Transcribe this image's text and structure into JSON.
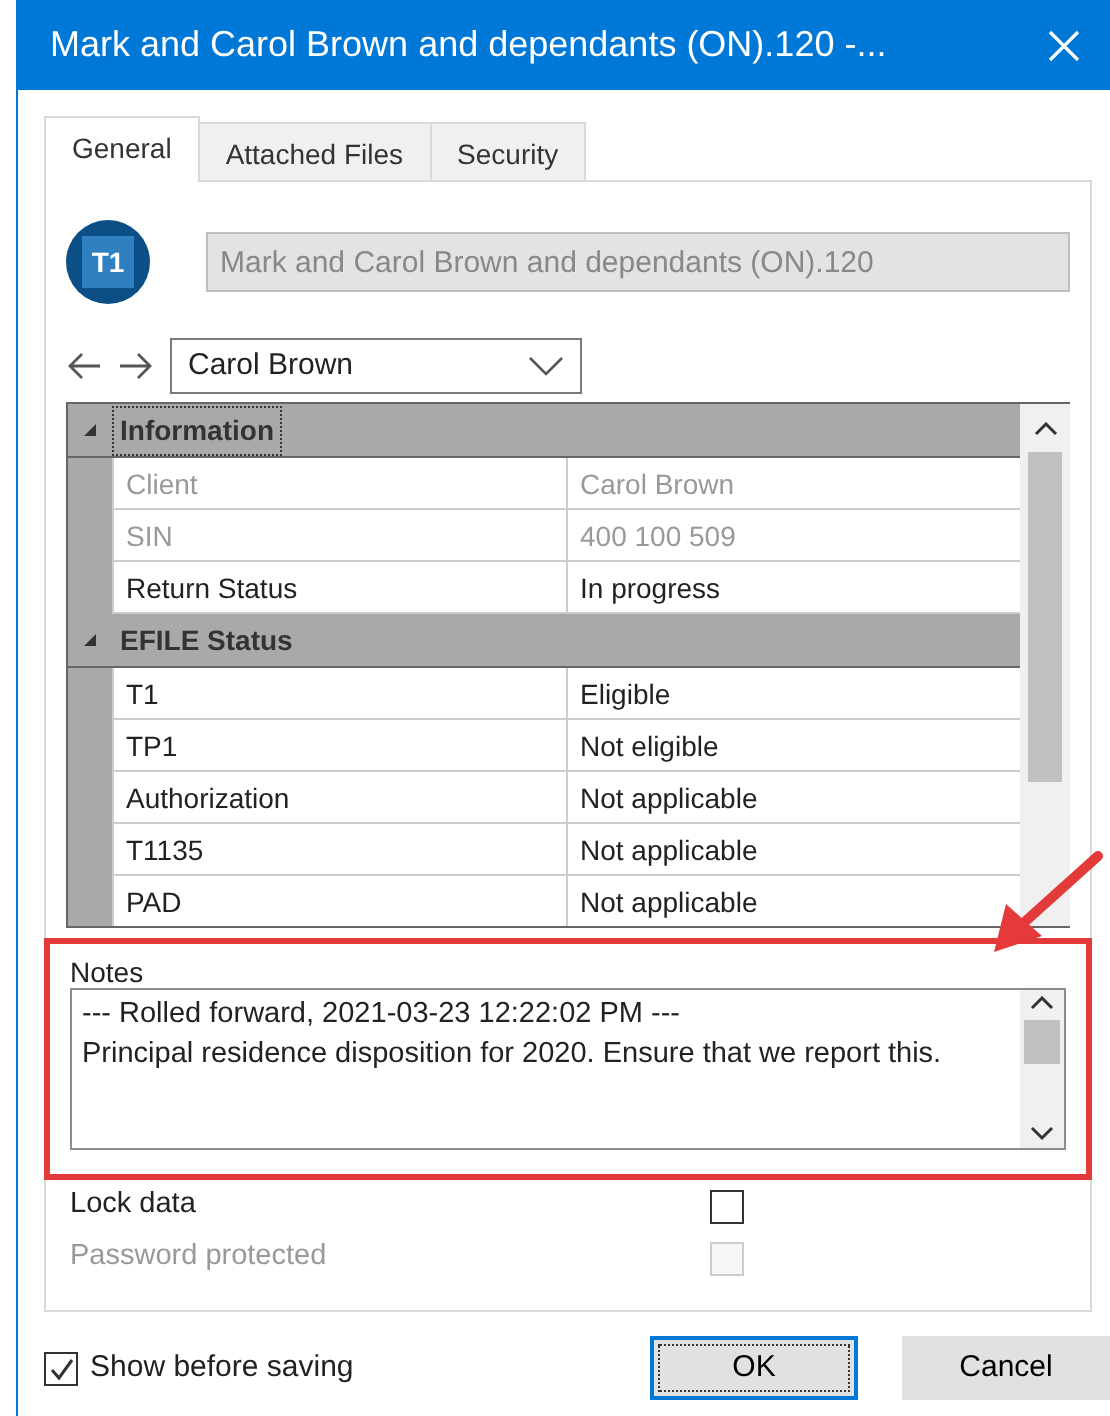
{
  "window": {
    "title": "Mark and Carol Brown and dependants (ON).120 -..."
  },
  "tabs": [
    {
      "label": "General",
      "selected": true
    },
    {
      "label": "Attached Files",
      "selected": false
    },
    {
      "label": "Security",
      "selected": false
    }
  ],
  "header": {
    "badge": "T1",
    "file_name": "Mark and Carol Brown and dependants (ON).120",
    "disabled": true
  },
  "person_select": {
    "value": "Carol Brown"
  },
  "property_grid": {
    "sections": [
      {
        "title": "Information",
        "expanded": true,
        "focused": true,
        "rows": [
          {
            "label": "Client",
            "value": "Carol Brown",
            "disabled": true
          },
          {
            "label": "SIN",
            "value": "400 100 509",
            "disabled": true
          },
          {
            "label": "Return Status",
            "value": "In progress",
            "disabled": false
          }
        ]
      },
      {
        "title": "EFILE Status",
        "expanded": true,
        "focused": false,
        "rows": [
          {
            "label": "T1",
            "value": "Eligible",
            "disabled": false
          },
          {
            "label": "TP1",
            "value": "Not eligible",
            "disabled": false
          },
          {
            "label": "Authorization",
            "value": "Not applicable",
            "disabled": false
          },
          {
            "label": "T1135",
            "value": "Not applicable",
            "disabled": false
          },
          {
            "label": "PAD",
            "value": "Not applicable",
            "disabled": false
          }
        ]
      }
    ]
  },
  "notes": {
    "label": "Notes",
    "highlighted": true,
    "lines": [
      "--- Rolled forward, 2021-03-23 12:22:02 PM ---",
      "Principal residence disposition for 2020. Ensure that we report this."
    ]
  },
  "options": [
    {
      "label": "Lock data",
      "checked": false,
      "disabled": false
    },
    {
      "label": "Password protected",
      "checked": false,
      "disabled": true
    }
  ],
  "show_before_saving": {
    "label": "Show before saving",
    "checked": true
  },
  "buttons": [
    {
      "label": "OK",
      "default": true
    },
    {
      "label": "Cancel",
      "default": false
    }
  ]
}
